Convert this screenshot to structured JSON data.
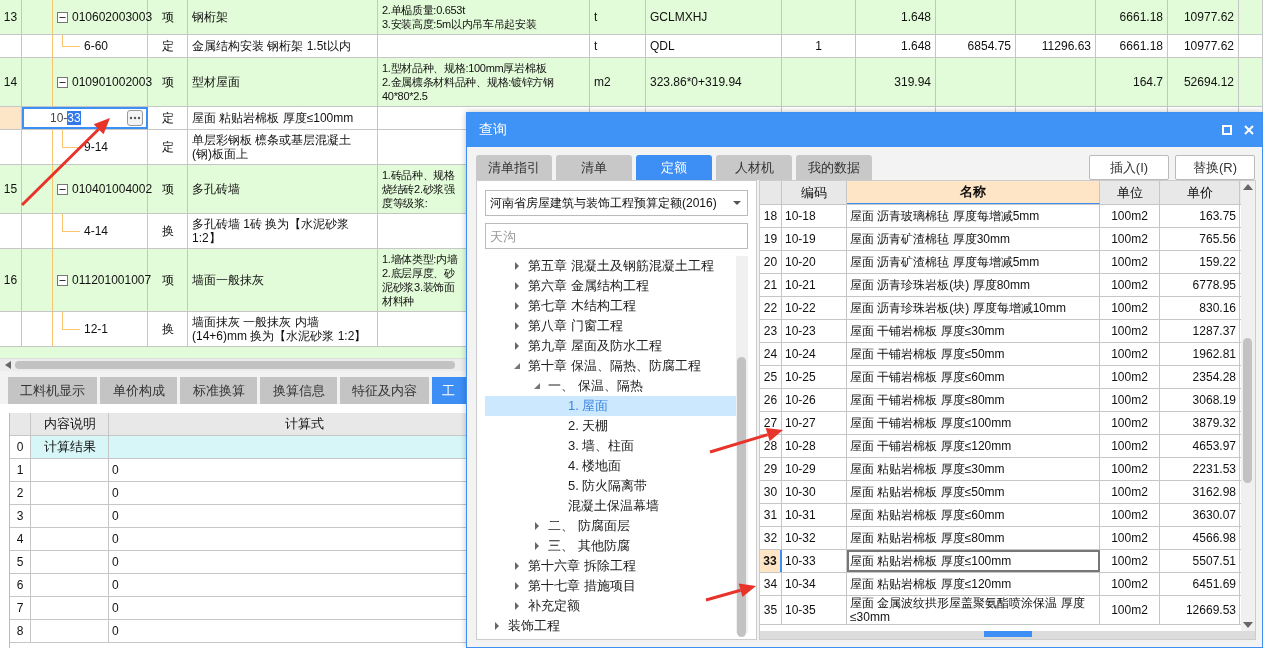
{
  "background_table": {
    "rows": [
      {
        "kind": "item",
        "number": "13",
        "code": "010602003003",
        "type": "项",
        "name": "钢桁架",
        "features": "2.单榀质量:0.653t\n3.安装高度:5m以内吊车吊起安装",
        "cells": [
          "t",
          "GCLMXHJ",
          null,
          "1.648",
          null,
          null,
          "6661.18",
          "10977.62"
        ],
        "expanded": true,
        "selected": false
      },
      {
        "kind": "quota",
        "code": "6-60",
        "type": "定",
        "name": "金属结构安装 钢桁架 1.5t以内",
        "cells": [
          "t",
          "QDL",
          "1",
          "1.648",
          "6854.75",
          "11296.63",
          "6661.18",
          "10977.62"
        ],
        "selected": false
      },
      {
        "kind": "item",
        "number": "14",
        "code": "010901002003",
        "type": "项",
        "name": "型材屋面",
        "features": "1.型材品种、规格:100mm厚岩棉板\n2.金属檩条材料品种、规格:镀锌方钢\n40*80*2.5",
        "cells": [
          "m2",
          "323.86*0+319.94",
          null,
          "319.94",
          null,
          null,
          "164.7",
          "52694.12"
        ],
        "expanded": true,
        "selected": false
      },
      {
        "kind": "quota",
        "editing": {
          "value": "10-",
          "selection": "33"
        },
        "type": "定",
        "name": "屋面 粘贴岩棉板 厚度≤100mm",
        "selected": true
      },
      {
        "kind": "quota",
        "code": "9-14",
        "type": "定",
        "name": "单层彩钢板 檩条或基层混凝土\n(钢)板面上",
        "selected": false
      },
      {
        "kind": "item",
        "number": "15",
        "code": "010401004002",
        "type": "项",
        "name": "多孔砖墙",
        "features": "1.砖品种、规格烧结砖2.砂浆强度等级浆:",
        "expanded": true,
        "selected": false
      },
      {
        "kind": "quota",
        "code": "4-14",
        "type": "换",
        "name": "多孔砖墙 1砖  换为【水泥砂浆\n1:2】",
        "selected": false
      },
      {
        "kind": "item",
        "number": "16",
        "code": "011201001007",
        "type": "项",
        "name": "墙面一般抹灰",
        "features": "1.墙体类型:内墙2.底层厚度、砂泥砂浆3.装饰面材料种",
        "expanded": true,
        "selected": false
      },
      {
        "kind": "quota",
        "code": "12-1",
        "type": "换",
        "name": "墙面抹灰 一般抹灰 内墙\n(14+6)mm  换为【水泥砂浆 1:2】",
        "selected": false
      }
    ]
  },
  "bottom_tabs": [
    {
      "label": "工料机显示",
      "selected": false
    },
    {
      "label": "单价构成",
      "selected": false
    },
    {
      "label": "标准换算",
      "selected": false
    },
    {
      "label": "换算信息",
      "selected": false
    },
    {
      "label": "特征及内容",
      "selected": false
    },
    {
      "label": "工",
      "selected": true
    }
  ],
  "calc_table": {
    "columns": [
      "内容说明",
      "计算式"
    ],
    "rows": [
      {
        "kind": "result",
        "number": "0",
        "description": "计算结果"
      },
      {
        "kind": "line",
        "number": "1",
        "formula": "0"
      },
      {
        "kind": "line",
        "number": "2",
        "formula": "0"
      },
      {
        "kind": "line",
        "number": "3",
        "formula": "0"
      },
      {
        "kind": "line",
        "number": "4",
        "formula": "0"
      },
      {
        "kind": "line",
        "number": "5",
        "formula": "0"
      },
      {
        "kind": "line",
        "number": "6",
        "formula": "0"
      },
      {
        "kind": "line",
        "number": "7",
        "formula": "0"
      },
      {
        "kind": "line",
        "number": "8",
        "formula": "0"
      }
    ]
  },
  "dialog": {
    "title": "查询",
    "tabs": [
      {
        "label": "清单指引",
        "selected": false
      },
      {
        "label": "清单",
        "selected": false
      },
      {
        "label": "定额",
        "selected": true
      },
      {
        "label": "人材机",
        "selected": false
      },
      {
        "label": "我的数据",
        "selected": false
      }
    ],
    "buttons": [
      "插入(I)",
      "替换(R)"
    ],
    "library": "河南省房屋建筑与装饰工程预算定额(2016)",
    "search": {
      "placeholder": "天沟"
    },
    "tree": [
      {
        "children": [
          {
            "label": "第五章 混凝土及钢筋混凝土工程",
            "expanded": false,
            "selected": false
          },
          {
            "label": "第六章 金属结构工程",
            "expanded": false,
            "selected": false
          },
          {
            "label": "第七章 木结构工程",
            "expanded": false,
            "selected": false
          },
          {
            "label": "第八章 门窗工程",
            "expanded": false,
            "selected": false
          },
          {
            "label": "第九章 屋面及防水工程",
            "expanded": false,
            "selected": false
          },
          {
            "label": "第十章 保温、隔热、防腐工程",
            "expanded": true,
            "selected": false,
            "children": [
              {
                "label": "一、 保温、隔热",
                "expanded": true,
                "selected": false,
                "children": [
                  {
                    "label": "1. 屋面",
                    "selected": true
                  },
                  {
                    "label": "2. 天棚",
                    "selected": false
                  },
                  {
                    "label": "3. 墙、柱面",
                    "selected": false
                  },
                  {
                    "label": "4. 楼地面",
                    "selected": false
                  },
                  {
                    "label": "5. 防火隔离带",
                    "selected": false
                  },
                  {
                    "label": "混凝土保温幕墙",
                    "selected": false
                  }
                ]
              },
              {
                "label": "二、 防腐面层",
                "expanded": false,
                "selected": false
              },
              {
                "label": "三、 其他防腐",
                "expanded": false,
                "selected": false
              }
            ]
          },
          {
            "label": "第十六章 拆除工程",
            "expanded": false,
            "selected": false
          },
          {
            "label": "第十七章 措施项目",
            "expanded": false,
            "selected": false
          },
          {
            "label": "补充定额",
            "expanded": false,
            "selected": false
          }
        ]
      },
      {
        "label": "装饰工程",
        "expanded": false,
        "selected": false
      }
    ],
    "table": {
      "columns": [
        {
          "label": "编码",
          "selected": false
        },
        {
          "label": "名称",
          "selected": true
        },
        {
          "label": "单位",
          "selected": false
        },
        {
          "label": "单价",
          "selected": false
        }
      ],
      "rows": [
        {
          "number": "18",
          "code": "10-18",
          "name": "屋面 沥青玻璃棉毡 厚度每增减5mm",
          "unit": "100m2",
          "price": "163.75",
          "selected": false
        },
        {
          "number": "19",
          "code": "10-19",
          "name": "屋面 沥青矿渣棉毡 厚度30mm",
          "unit": "100m2",
          "price": "765.56",
          "selected": false
        },
        {
          "number": "20",
          "code": "10-20",
          "name": "屋面 沥青矿渣棉毡 厚度每增减5mm",
          "unit": "100m2",
          "price": "159.22",
          "selected": false
        },
        {
          "number": "21",
          "code": "10-21",
          "name": "屋面 沥青珍珠岩板(块) 厚度80mm",
          "unit": "100m2",
          "price": "6778.95",
          "selected": false
        },
        {
          "number": "22",
          "code": "10-22",
          "name": "屋面 沥青珍珠岩板(块) 厚度每增减10mm",
          "unit": "100m2",
          "price": "830.16",
          "selected": false
        },
        {
          "number": "23",
          "code": "10-23",
          "name": "屋面 干铺岩棉板 厚度≤30mm",
          "unit": "100m2",
          "price": "1287.37",
          "selected": false
        },
        {
          "number": "24",
          "code": "10-24",
          "name": "屋面 干铺岩棉板 厚度≤50mm",
          "unit": "100m2",
          "price": "1962.81",
          "selected": false
        },
        {
          "number": "25",
          "code": "10-25",
          "name": "屋面 干铺岩棉板 厚度≤60mm",
          "unit": "100m2",
          "price": "2354.28",
          "selected": false
        },
        {
          "number": "26",
          "code": "10-26",
          "name": "屋面 干铺岩棉板 厚度≤80mm",
          "unit": "100m2",
          "price": "3068.19",
          "selected": false
        },
        {
          "number": "27",
          "code": "10-27",
          "name": "屋面 干铺岩棉板 厚度≤100mm",
          "unit": "100m2",
          "price": "3879.32",
          "selected": false
        },
        {
          "number": "28",
          "code": "10-28",
          "name": "屋面 干铺岩棉板 厚度≤120mm",
          "unit": "100m2",
          "price": "4653.97",
          "selected": false
        },
        {
          "number": "29",
          "code": "10-29",
          "name": "屋面 粘贴岩棉板 厚度≤30mm",
          "unit": "100m2",
          "price": "2231.53",
          "selected": false
        },
        {
          "number": "30",
          "code": "10-30",
          "name": "屋面 粘贴岩棉板 厚度≤50mm",
          "unit": "100m2",
          "price": "3162.98",
          "selected": false
        },
        {
          "number": "31",
          "code": "10-31",
          "name": "屋面 粘贴岩棉板 厚度≤60mm",
          "unit": "100m2",
          "price": "3630.07",
          "selected": false
        },
        {
          "number": "32",
          "code": "10-32",
          "name": "屋面 粘贴岩棉板 厚度≤80mm",
          "unit": "100m2",
          "price": "4566.98",
          "selected": false
        },
        {
          "number": "33",
          "code": "10-33",
          "name": "屋面 粘贴岩棉板 厚度≤100mm",
          "unit": "100m2",
          "price": "5507.51",
          "selected": true
        },
        {
          "number": "34",
          "code": "10-34",
          "name": "屋面 粘贴岩棉板 厚度≤120mm",
          "unit": "100m2",
          "price": "6451.69",
          "selected": false
        },
        {
          "number": "35",
          "code": "10-35",
          "name": "屋面 金属波纹拱形屋盖聚氨酯喷涂保温 厚度≤30mm",
          "unit": "100m2",
          "price": "12669.53",
          "selected": false
        }
      ]
    }
  }
}
